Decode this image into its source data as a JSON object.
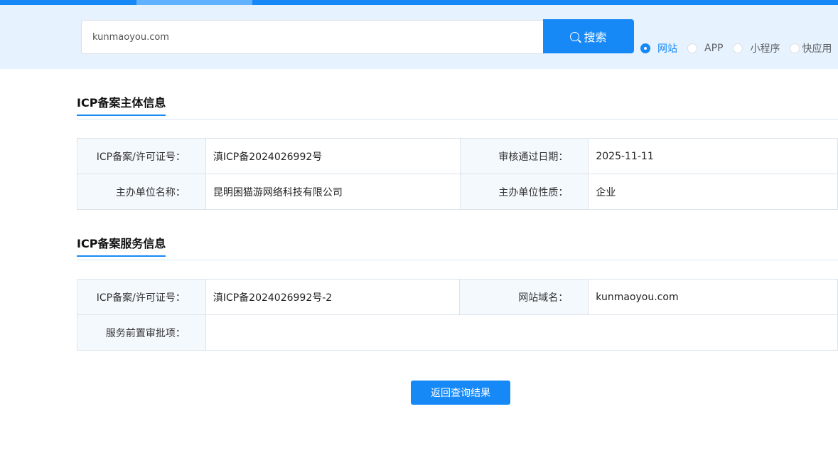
{
  "search": {
    "value": "kunmaoyou.com",
    "placeholder": "",
    "button_label": "搜索"
  },
  "search_types": [
    {
      "label": "网站",
      "checked": true
    },
    {
      "label": "APP",
      "checked": false
    },
    {
      "label": "小程序",
      "checked": false
    },
    {
      "label": "快应用",
      "checked": false
    }
  ],
  "subject_info": {
    "title": "ICP备案主体信息",
    "rows": [
      {
        "label1": "ICP备案/许可证号：",
        "value1": "滇ICP备2024026992号",
        "label2": "审核通过日期：",
        "value2": "2025-11-11"
      },
      {
        "label1": "主办单位名称：",
        "value1": "昆明困猫游网络科技有限公司",
        "label2": "主办单位性质：",
        "value2": "企业"
      }
    ]
  },
  "service_info": {
    "title": "ICP备案服务信息",
    "rows": [
      {
        "label1": "ICP备案/许可证号：",
        "value1": "滇ICP备2024026992号-2",
        "label2": "网站域名：",
        "value2": "kunmaoyou.com"
      },
      {
        "label1": "服务前置审批项：",
        "value1": ""
      }
    ]
  },
  "actions": {
    "back_label": "返回查询结果"
  },
  "colors": {
    "accent": "#1789f7",
    "band": "#e6f2fe",
    "label_bg": "#f4f9fe"
  }
}
